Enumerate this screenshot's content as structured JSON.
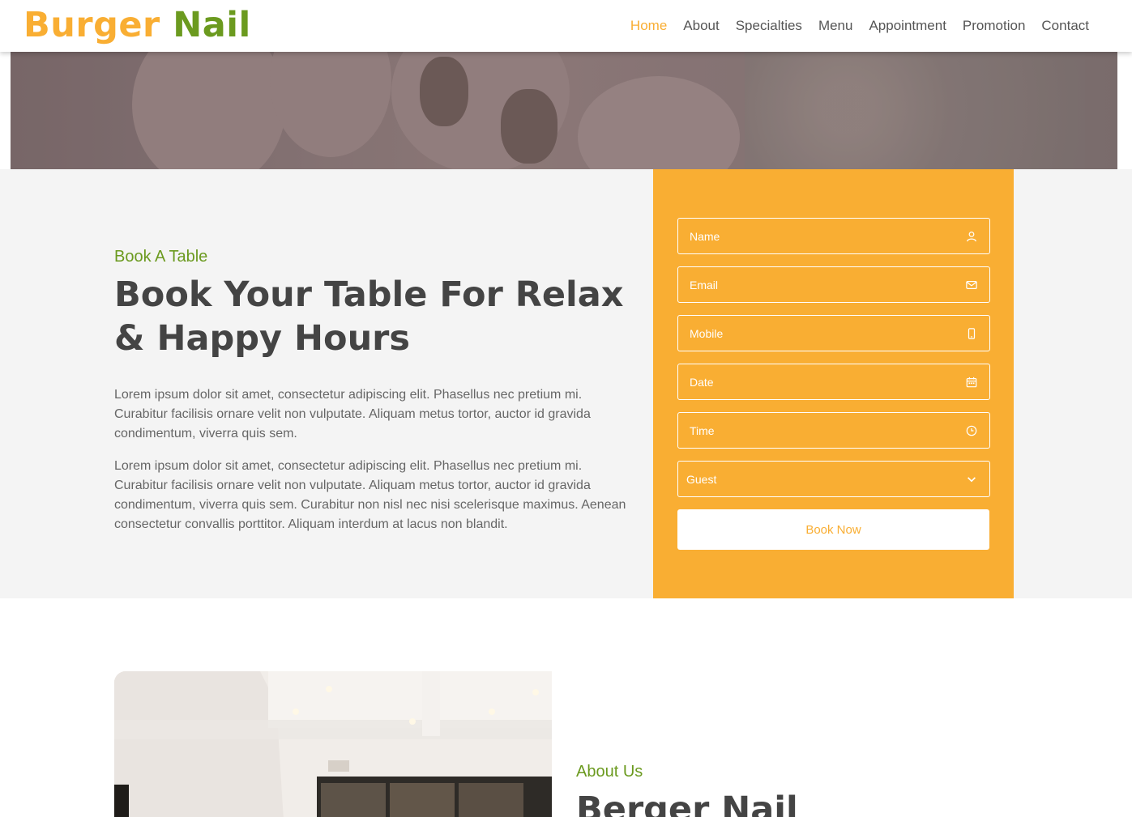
{
  "brand": {
    "word1": "Burger",
    "word2": "Nail"
  },
  "nav": {
    "items": [
      {
        "label": "Home",
        "active": true
      },
      {
        "label": "About"
      },
      {
        "label": "Specialties"
      },
      {
        "label": "Menu"
      },
      {
        "label": "Appointment"
      },
      {
        "label": "Promotion"
      },
      {
        "label": "Contact"
      }
    ]
  },
  "booking": {
    "subtitle": "Book A Table",
    "title": "Book Your Table For Relax & Happy Hours",
    "paragraph1": "Lorem ipsum dolor sit amet, consectetur adipiscing elit. Phasellus nec pretium mi. Curabitur facilisis ornare velit non vulputate. Aliquam metus tortor, auctor id gravida condimentum, viverra quis sem.",
    "paragraph2": "Lorem ipsum dolor sit amet, consectetur adipiscing elit. Phasellus nec pretium mi. Curabitur facilisis ornare velit non vulputate. Aliquam metus tortor, auctor id gravida condimentum, viverra quis sem. Curabitur non nisl nec nisi scelerisque maximus. Aenean consectetur convallis porttitor. Aliquam interdum at lacus non blandit."
  },
  "form": {
    "name_placeholder": "Name",
    "email_placeholder": "Email",
    "mobile_placeholder": "Mobile",
    "date_placeholder": "Date",
    "time_placeholder": "Time",
    "guest_selected": "Guest",
    "submit_label": "Book Now"
  },
  "about": {
    "subtitle": "About Us",
    "title": "Berger Nail"
  },
  "colors": {
    "accent": "#f9ae33",
    "green": "#6b9a1f",
    "text": "#444444"
  }
}
